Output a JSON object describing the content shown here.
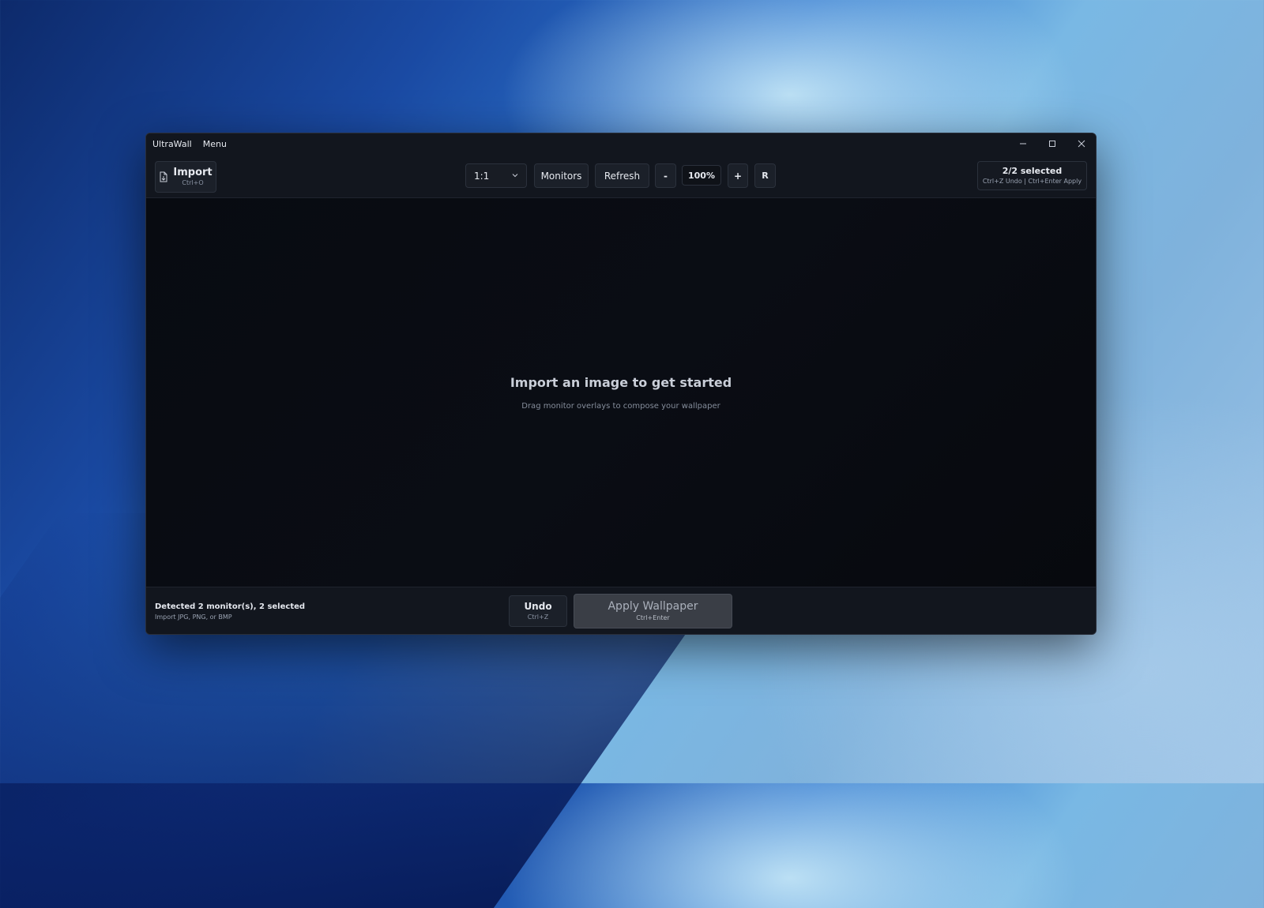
{
  "window": {
    "app_title": "UltraWall",
    "menu_label": "Menu",
    "controls": [
      "minimize-icon",
      "maximize-icon",
      "close-icon"
    ]
  },
  "toolbar": {
    "import_label": "Import",
    "import_shortcut": "Ctrl+O",
    "import_icon": "import-file-icon",
    "ratio_value": "1:1",
    "monitors_label": "Monitors",
    "refresh_label": "Refresh",
    "zoom_out_label": "-",
    "zoom_value": "100%",
    "zoom_in_label": "+",
    "reset_label": "R",
    "selected_count": "2/2 selected",
    "shortcut_hint": "Ctrl+Z Undo  |  Ctrl+Enter Apply"
  },
  "canvas": {
    "empty_title": "Import an image to get started",
    "empty_subtitle": "Drag monitor overlays to compose your wallpaper"
  },
  "statusbar": {
    "status_text": "Detected 2 monitor(s), 2 selected",
    "formats_hint": "Import JPG, PNG, or BMP",
    "undo_label": "Undo",
    "undo_shortcut": "Ctrl+Z",
    "apply_label": "Apply Wallpaper",
    "apply_shortcut": "Ctrl+Enter"
  },
  "colors": {
    "window_bg": "#0d1016",
    "toolbar_bg": "#12161e",
    "button_bg": "#1b2029",
    "apply_disabled_bg": "#3a3e46"
  }
}
